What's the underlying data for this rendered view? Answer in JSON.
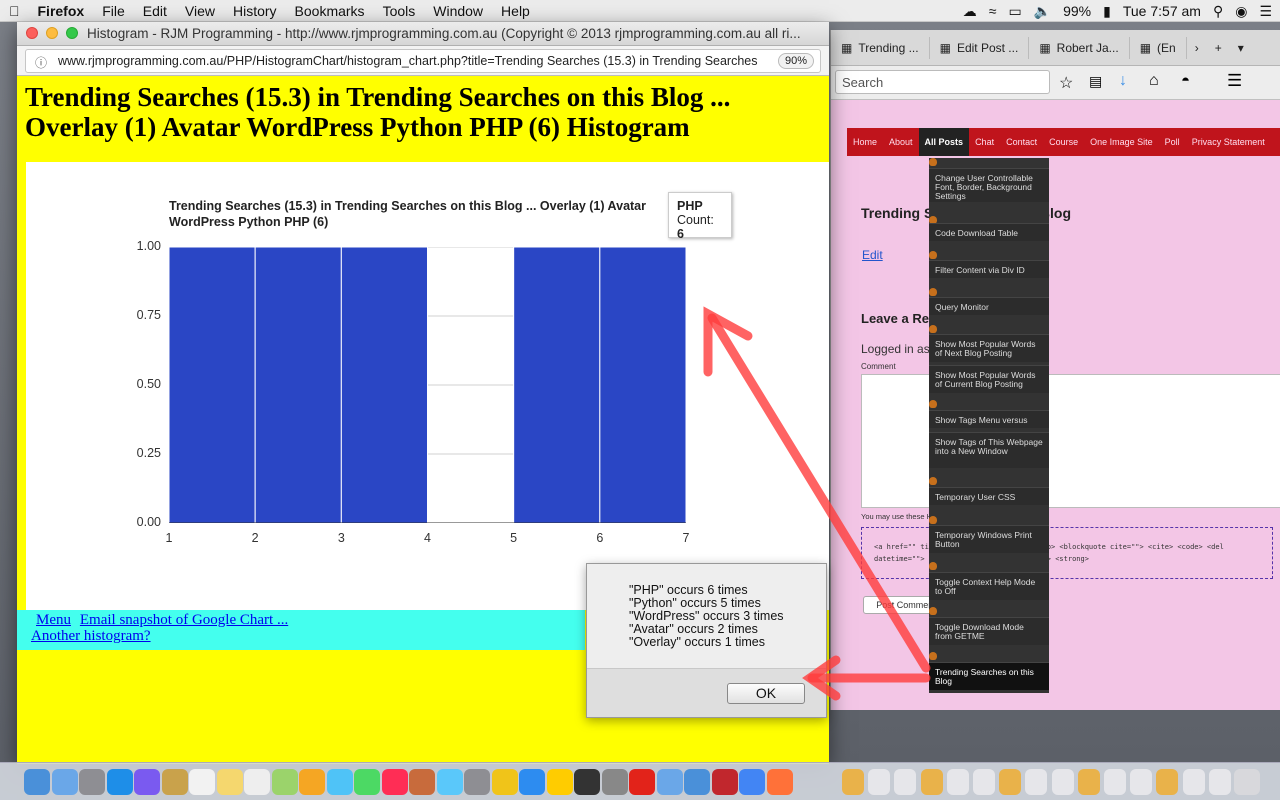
{
  "menubar": {
    "apple": "",
    "app": "Firefox",
    "items": [
      "File",
      "Edit",
      "View",
      "History",
      "Bookmarks",
      "Tools",
      "Window",
      "Help"
    ],
    "battery": "99%",
    "clock": "Tue 7:57 am"
  },
  "bg_window": {
    "tabs": [
      "Trending ...",
      "Edit Post ...",
      "Robert Ja...",
      "(En"
    ],
    "search_placeholder": "Search",
    "nav": [
      "Home",
      "About",
      "All Posts",
      "Chat",
      "Contact",
      "Course",
      "One Image Site",
      "Poll",
      "Privacy Statement"
    ],
    "post_title": "Trending Searches on this Blog",
    "edit_link": "Edit",
    "leave_reply": "Leave a Reply",
    "logged_in": "Logged in as",
    "comment_label": "Comment",
    "tags_note": "You may use these HTML tags and attributes:",
    "tags_code": "<a href=\"\" title=\"\"> <acronym title=\"\"> <b> <blockquote cite=\"\"> <cite> <code> <del datetime=\"\"> <em> <i> <q cite=\"\"> <strike> <strong>",
    "post_comment": "Post Comment",
    "dropdown": [
      "Change User Controllable Font, Border, Background Settings",
      "Code Download Table",
      "Filter Content via Div ID",
      "Query Monitor",
      "Show Most Popular Words of Next Blog Posting",
      "Show Most Popular Words of Current Blog Posting",
      "Show Tags Menu versus",
      "Show Tags of This Webpage into a New Window",
      "Temporary User CSS",
      "Temporary Windows Print Button",
      "Toggle Context Help Mode to Off",
      "Toggle Download Mode from GETME",
      "Trending Searches on this Blog"
    ]
  },
  "main_window": {
    "title": "Histogram - RJM Programming - http://www.rjmprogramming.com.au (Copyright © 2013 rjmprogramming.com.au all ri...",
    "url": "www.rjmprogramming.com.au/PHP/HistogramChart/histogram_chart.php?title=Trending Searches (15.3) in Trending Searches",
    "zoom": "90%",
    "heading": "Trending Searches (15.3) in Trending Searches on this Blog ... Overlay (1) Avatar WordPress Python PHP (6) Histogram",
    "links": {
      "menu": "Menu",
      "email": "Email snapshot of Google Chart ...",
      "another": "Another histogram?"
    }
  },
  "chart_data": {
    "type": "bar",
    "title": "Trending Searches (15.3) in Trending Searches on this Blog ... Overlay (1) Avatar WordPress Python PHP (6)",
    "x": [
      1,
      2,
      3,
      4,
      5,
      6
    ],
    "bins": [
      [
        1,
        2
      ],
      [
        2,
        3
      ],
      [
        3,
        4
      ],
      [
        4,
        5
      ],
      [
        5,
        6
      ],
      [
        6,
        7
      ]
    ],
    "values": [
      1,
      1,
      1,
      0,
      1,
      1
    ],
    "xticks": [
      "1",
      "2",
      "3",
      "4",
      "5",
      "6",
      "7"
    ],
    "yticks": [
      "0.00",
      "0.25",
      "0.50",
      "0.75",
      "1.00"
    ],
    "ylim": [
      0,
      1
    ],
    "xlim": [
      1,
      7
    ],
    "bar_color": "#2a46c5",
    "grid": true,
    "tooltip": {
      "label": "PHP",
      "count_label": "Count:",
      "count": "6"
    }
  },
  "dialog": {
    "message": "\"PHP\" occurs 6 times\n\"Python\" occurs 5 times\n\"WordPress\" occurs 3 times\n\"Avatar\" occurs 2 times\n\"Overlay\" occurs 1 times",
    "ok": "OK"
  },
  "annotation_color": "#ff3c3c"
}
